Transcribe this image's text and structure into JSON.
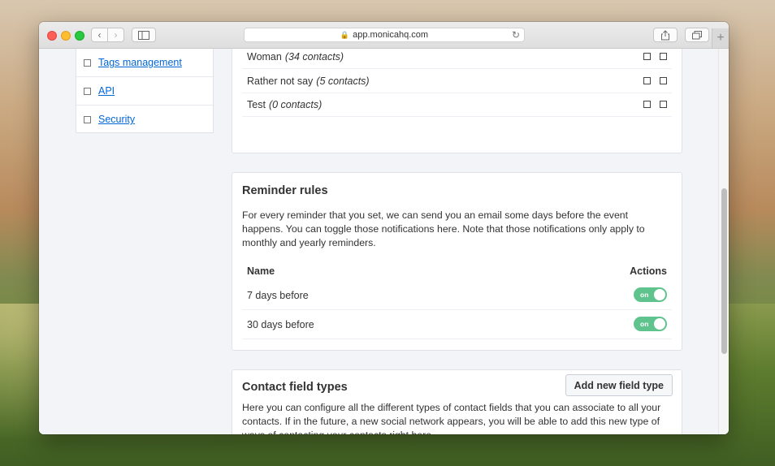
{
  "browser": {
    "url": "app.monicahq.com"
  },
  "sidebar": {
    "items": [
      {
        "label": "Tags management"
      },
      {
        "label": "API"
      },
      {
        "label": "Security"
      }
    ]
  },
  "genders": {
    "rows": [
      {
        "name": "Woman",
        "count": "(34 contacts)"
      },
      {
        "name": "Rather not say",
        "count": "(5 contacts)"
      },
      {
        "name": "Test",
        "count": "(0 contacts)"
      }
    ]
  },
  "reminder_rules": {
    "title": "Reminder rules",
    "description": "For every reminder that you set, we can send you an email some days before the event happens. You can toggle those notifications here. Note that those notifications only apply to monthly and yearly reminders.",
    "col_name": "Name",
    "col_actions": "Actions",
    "rows": [
      {
        "name": "7 days before",
        "toggle_label": "on",
        "enabled": true
      },
      {
        "name": "30 days before",
        "toggle_label": "on",
        "enabled": true
      }
    ]
  },
  "contact_field_types": {
    "title": "Contact field types",
    "add_button": "Add new field type",
    "description": "Here you can configure all the different types of contact fields that you can associate to all your contacts. If in the future, a new social network appears, you will be able to add this new type of ways of contacting your contacts right here."
  },
  "colors": {
    "link": "#0366d6",
    "toggle_on": "#5fc38d"
  }
}
